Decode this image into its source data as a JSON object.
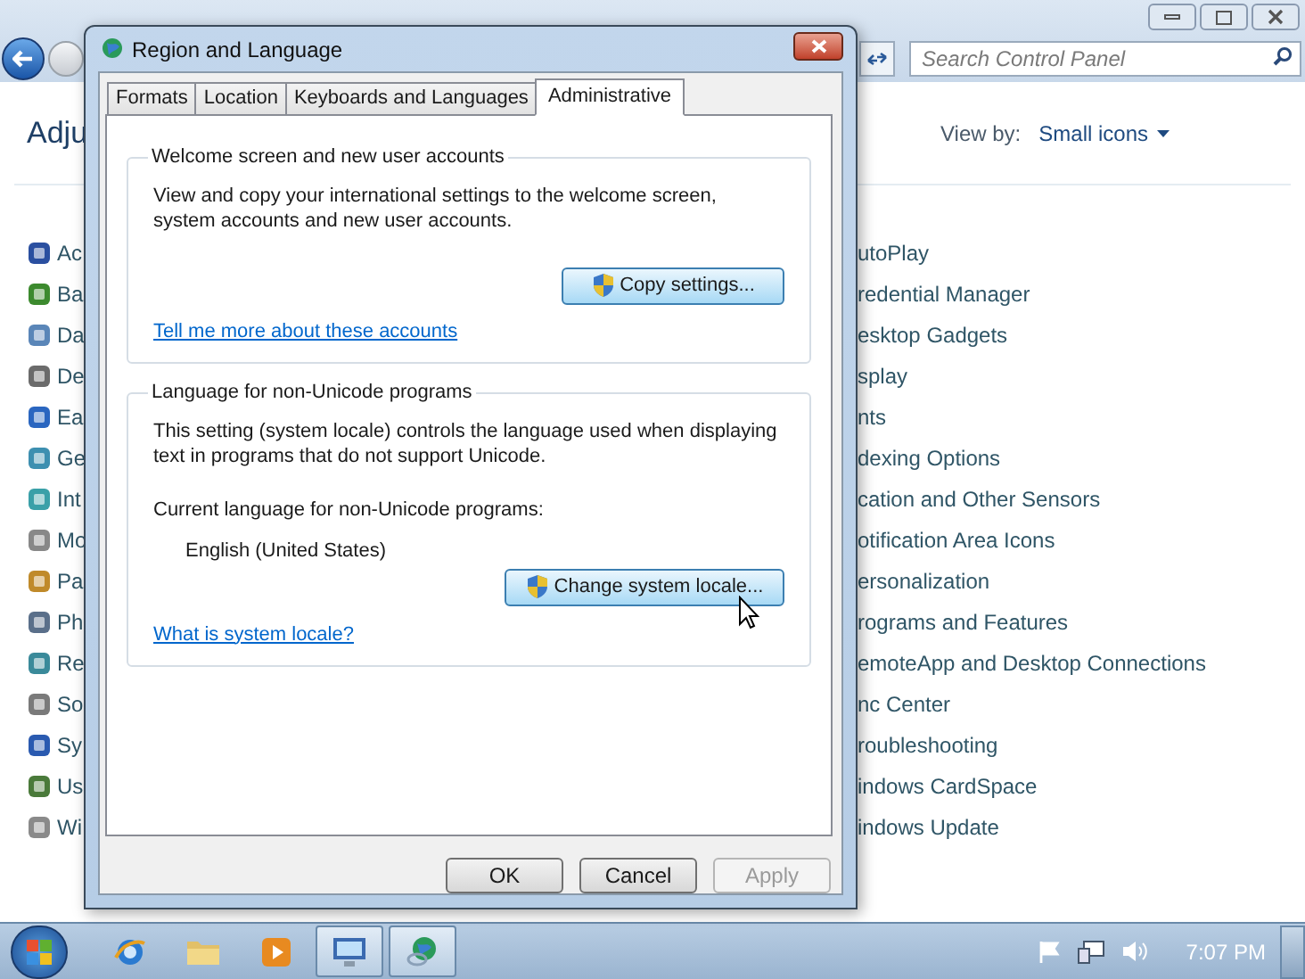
{
  "control_panel": {
    "search": {
      "placeholder": "Search Control Panel"
    },
    "heading": "Adju",
    "view_by": {
      "label": "View by:",
      "value": "Small icons"
    },
    "left_items": [
      "Ac",
      "Ba",
      "Da",
      "De",
      "Ea",
      "Ge",
      "Int",
      "Mo",
      "Pa",
      "Ph",
      "Re",
      "So",
      "Sy",
      "Us",
      "Wi"
    ],
    "right_items": [
      "utoPlay",
      "redential Manager",
      "esktop Gadgets",
      "splay",
      "nts",
      "dexing Options",
      "cation and Other Sensors",
      "otification Area Icons",
      "ersonalization",
      "rograms and Features",
      "emoteApp and Desktop Connections",
      "nc Center",
      "roubleshooting",
      "indows CardSpace",
      "indows Update"
    ]
  },
  "dialog": {
    "title": "Region and Language",
    "tabs": [
      {
        "label": "Formats",
        "selected": false
      },
      {
        "label": "Location",
        "selected": false
      },
      {
        "label": "Keyboards and Languages",
        "selected": false
      },
      {
        "label": "Administrative",
        "selected": true
      }
    ],
    "groups": [
      {
        "legend": "Welcome screen and new user accounts",
        "description": "View and copy your international settings to the welcome screen, system accounts and new user accounts.",
        "button": "Copy settings...",
        "link": "Tell me more about these accounts"
      },
      {
        "legend": "Language for non-Unicode programs",
        "description": "This setting (system locale) controls the language used when displaying text in programs that do not support Unicode.",
        "current_label": "Current language for non-Unicode programs:",
        "current_value": "English (United States)",
        "button": "Change system locale...",
        "link": "What is system locale?"
      }
    ],
    "buttons": [
      {
        "label": "OK",
        "disabled": false
      },
      {
        "label": "Cancel",
        "disabled": false
      },
      {
        "label": "Apply",
        "disabled": true
      }
    ]
  },
  "taskbar": {
    "items": [
      {
        "kind": "browser",
        "running": false
      },
      {
        "kind": "folder",
        "running": false
      },
      {
        "kind": "media",
        "running": false
      },
      {
        "kind": "display",
        "running": true
      },
      {
        "kind": "globe",
        "running": true
      }
    ],
    "clock": "7:07 PM"
  }
}
